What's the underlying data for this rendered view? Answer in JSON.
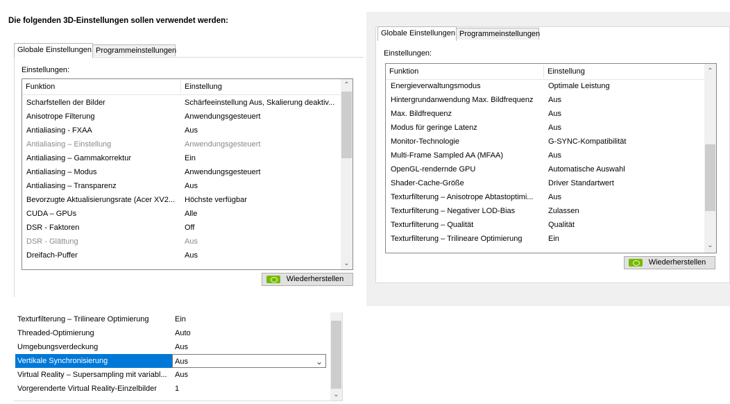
{
  "heading": "Die folgenden 3D-Einstellungen sollen verwendet werden:",
  "left": {
    "tabs": [
      "Globale Einstellungen",
      "Programmeinstellungen"
    ],
    "settings_label": "Einstellungen:",
    "columns": [
      "Funktion",
      "Einstellung"
    ],
    "rows": [
      {
        "f": "Scharfstellen der Bilder",
        "v": "Schärfeeinstellung Aus, Skalierung deaktiv..."
      },
      {
        "f": "Anisotrope Filterung",
        "v": "Anwendungsgesteuert"
      },
      {
        "f": "Antialiasing - FXAA",
        "v": "Aus"
      },
      {
        "f": "Antialiasing – Einstellung",
        "v": "Anwendungsgesteuert",
        "disabled": true
      },
      {
        "f": "Antialiasing – Gammakorrektur",
        "v": "Ein"
      },
      {
        "f": "Antialiasing – Modus",
        "v": "Anwendungsgesteuert"
      },
      {
        "f": "Antialiasing – Transparenz",
        "v": "Aus"
      },
      {
        "f": "Bevorzugte Aktualisierungsrate (Acer XV2...",
        "v": "Höchste verfügbar"
      },
      {
        "f": "CUDA – GPUs",
        "v": "Alle"
      },
      {
        "f": "DSR - Faktoren",
        "v": "Off"
      },
      {
        "f": "DSR - Glättung",
        "v": "Aus",
        "disabled": true
      },
      {
        "f": "Dreifach-Puffer",
        "v": "Aus"
      }
    ],
    "restore_label": "Wiederherstellen"
  },
  "right": {
    "tabs": [
      "Globale Einstellungen",
      "Programmeinstellungen"
    ],
    "settings_label": "Einstellungen:",
    "columns": [
      "Funktion",
      "Einstellung"
    ],
    "rows": [
      {
        "f": "Energieverwaltungsmodus",
        "v": "Optimale Leistung"
      },
      {
        "f": "Hintergrundanwendung Max. Bildfrequenz",
        "v": "Aus"
      },
      {
        "f": "Max. Bildfrequenz",
        "v": "Aus"
      },
      {
        "f": "Modus für geringe Latenz",
        "v": "Aus"
      },
      {
        "f": "Monitor-Technologie",
        "v": "G-SYNC-Kompatibilität"
      },
      {
        "f": "Multi-Frame Sampled AA (MFAA)",
        "v": "Aus"
      },
      {
        "f": "OpenGL-rendernde GPU",
        "v": "Automatische Auswahl"
      },
      {
        "f": "Shader-Cache-Größe",
        "v": "Driver Standartwert"
      },
      {
        "f": "Texturfilterung – Anisotrope Abtastoptimi...",
        "v": "Aus"
      },
      {
        "f": "Texturfilterung – Negativer LOD-Bias",
        "v": "Zulassen"
      },
      {
        "f": "Texturfilterung – Qualität",
        "v": "Qualität"
      },
      {
        "f": "Texturfilterung – Trilineare Optimierung",
        "v": "Ein"
      }
    ],
    "restore_label": "Wiederherstellen"
  },
  "bottom": {
    "rows": [
      {
        "f": "Texturfilterung – Trilineare Optimierung",
        "v": "Ein"
      },
      {
        "f": "Threaded-Optimierung",
        "v": "Auto"
      },
      {
        "f": "Umgebungsverdeckung",
        "v": "Aus"
      },
      {
        "f": "Vertikale Synchronisierung",
        "v": "Aus",
        "selected": true
      },
      {
        "f": "Virtual Reality – Supersampling mit variabl...",
        "v": "Aus"
      },
      {
        "f": "Vorgerenderte Virtual Reality-Einzelbilder",
        "v": "1"
      }
    ]
  },
  "colors": {
    "selection": "#0078d7",
    "nvidia_green": "#76b900"
  }
}
